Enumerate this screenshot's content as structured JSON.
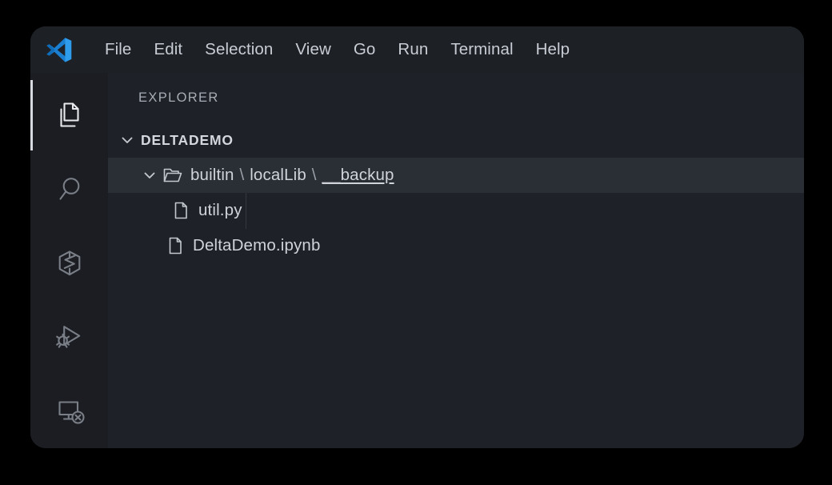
{
  "window": {
    "app_name": "Visual Studio Code",
    "logo_icon": "vscode-logo-icon"
  },
  "title_bar": {
    "menus": [
      {
        "label": "File",
        "name": "menu-file"
      },
      {
        "label": "Edit",
        "name": "menu-edit"
      },
      {
        "label": "Selection",
        "name": "menu-selection"
      },
      {
        "label": "View",
        "name": "menu-view"
      },
      {
        "label": "Go",
        "name": "menu-go"
      },
      {
        "label": "Run",
        "name": "menu-run"
      },
      {
        "label": "Terminal",
        "name": "menu-terminal"
      },
      {
        "label": "Help",
        "name": "menu-help"
      }
    ]
  },
  "activity_bar": {
    "items": [
      {
        "icon": "files-explorer-icon",
        "label": "Explorer",
        "active": true
      },
      {
        "icon": "search-icon",
        "label": "Search",
        "active": false
      },
      {
        "icon": "source-control-icon",
        "label": "Source Control",
        "active": false
      },
      {
        "icon": "run-and-debug-icon",
        "label": "Run and Debug",
        "active": false
      },
      {
        "icon": "remote-explorer-icon",
        "label": "Remote Explorer",
        "active": false
      }
    ]
  },
  "sidebar": {
    "title": "EXPLORER",
    "actions_label": "...",
    "tree": {
      "root": {
        "label": "DELTADEMO",
        "expanded": true,
        "twisty_icon": "chevron-down-icon"
      },
      "items": [
        {
          "kind": "folder",
          "depth": 1,
          "expanded": true,
          "selected": true,
          "twisty_icon": "chevron-down-icon",
          "icon": "folder-open-icon",
          "segments": [
            {
              "text": "builtin",
              "underlined": false
            },
            {
              "text": "\\",
              "separator": true
            },
            {
              "text": "localLib",
              "underlined": false
            },
            {
              "text": "\\",
              "separator": true
            },
            {
              "text": "__backup",
              "underlined": true
            }
          ],
          "label": "builtin\\localLib\\__backup"
        },
        {
          "kind": "file",
          "depth": 2,
          "selected": false,
          "icon": "file-icon",
          "label": "util.py"
        },
        {
          "kind": "file",
          "depth": 1,
          "selected": false,
          "icon": "file-icon",
          "label": "DeltaDemo.ipynb"
        }
      ]
    }
  },
  "colors": {
    "desktop_background": "#000000",
    "title_bar": "#1d2025",
    "activity_bar": "#1b1d22",
    "sidebar": "#1e2127",
    "selected_row": "#2a2e35",
    "text_primary": "#d0d4da",
    "text_muted": "#a7acb5",
    "icon_inactive": "#797e87",
    "icon_active": "#e8eaed",
    "logo_blue": "#2489d6"
  }
}
